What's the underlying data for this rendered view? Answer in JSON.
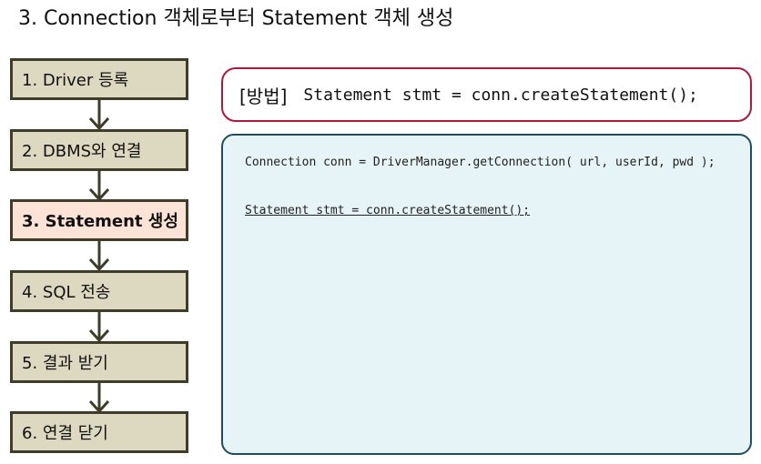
{
  "page": {
    "title": "3.  Connection 객체로부터 Statement 객체 생성"
  },
  "steps": [
    {
      "label": "1. Driver 등록",
      "active": false
    },
    {
      "label": "2.   DBMS와 연결",
      "active": false
    },
    {
      "label": "3.   Statement 생성",
      "active": true
    },
    {
      "label": "4.   SQL 전송",
      "active": false
    },
    {
      "label": "5.   결과 받기",
      "active": false
    },
    {
      "label": "6.   연결 닫기",
      "active": false
    }
  ],
  "method": {
    "label": "[방법]",
    "code": "Statement stmt = conn.createStatement();"
  },
  "example": {
    "lines": [
      "Connection conn = DriverManager.getConnection( url, userId, pwd );",
      "Statement stmt = conn.createStatement();"
    ]
  },
  "colors": {
    "step_fill": "#ddd8c0",
    "step_active_fill": "#fde3d6",
    "step_border": "#3d3d2a",
    "method_border": "#b0193a",
    "code_border": "#1f4e5f",
    "code_fill": "#e6f3f7"
  }
}
